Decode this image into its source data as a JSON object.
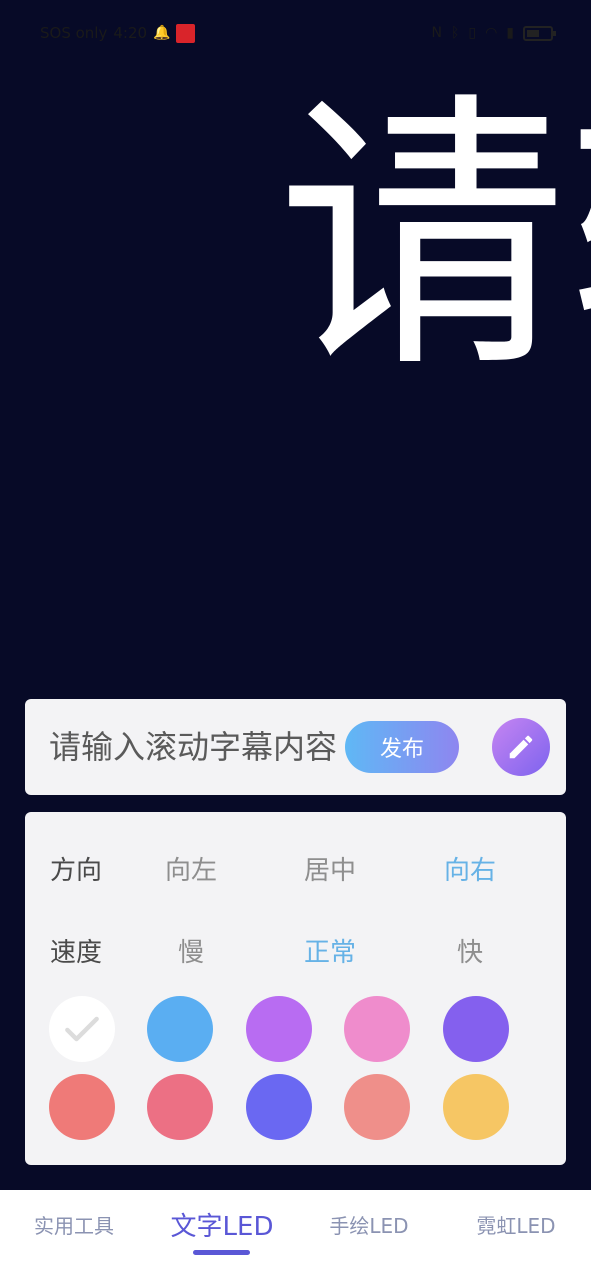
{
  "status_bar": {
    "carrier": "SOS only",
    "time": "4:20",
    "icons": [
      "bell-icon",
      "app-badge-icon",
      "nfc-icon",
      "bluetooth-icon",
      "vibrate-icon",
      "wifi-icon",
      "sim-icon",
      "battery-icon"
    ]
  },
  "led_preview": {
    "text": "请输",
    "background_color": "#070a27",
    "text_color": "#ffffff"
  },
  "input": {
    "placeholder": "请输入滚动字幕内容",
    "publish_label": "发布",
    "edit_icon": "pencil-icon"
  },
  "direction": {
    "label": "方向",
    "options": [
      "向左",
      "居中",
      "向右"
    ],
    "selected": "向右"
  },
  "speed": {
    "label": "速度",
    "options": [
      "慢",
      "正常",
      "快"
    ],
    "selected": "正常"
  },
  "colors": {
    "selected_index": 0,
    "swatches": [
      "#ffffff",
      "#5aaef2",
      "#b86cf2",
      "#ef8ccc",
      "#8460ee",
      "#ef7a78",
      "#ec7084",
      "#6a68f2",
      "#ef8f8a",
      "#f6c664"
    ]
  },
  "tabs": [
    {
      "label": "实用工具",
      "active": false
    },
    {
      "label": "文字LED",
      "active": true
    },
    {
      "label": "手绘LED",
      "active": false
    },
    {
      "label": "霓虹LED",
      "active": false
    }
  ]
}
